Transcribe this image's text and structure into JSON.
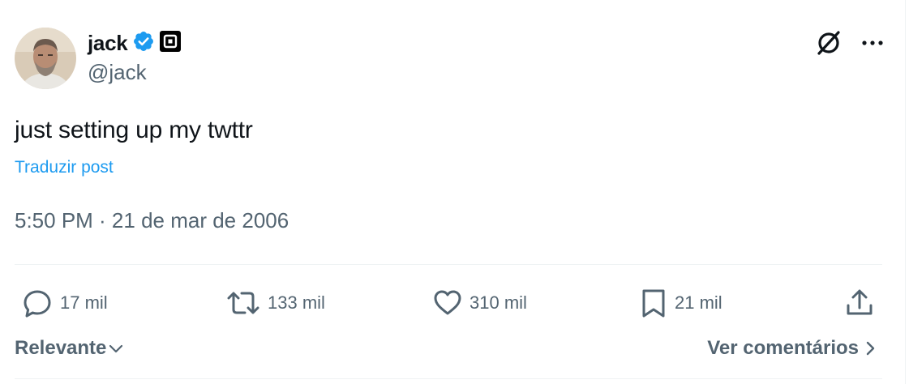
{
  "author": {
    "display_name": "jack",
    "handle": "@jack",
    "verified_icon": "verified-badge-icon",
    "affiliation_icon": "square-logo-icon"
  },
  "tweet": {
    "text": "just setting up my twttr",
    "translate_label": "Traduzir post",
    "timestamp": "5:50 PM · 21 de mar de 2006"
  },
  "actions": {
    "replies": "17 mil",
    "reposts": "133 mil",
    "likes": "310 mil",
    "bookmarks": "21 mil"
  },
  "replies_section": {
    "sort_label": "Relevante",
    "see_comments_label": "Ver comentários"
  },
  "colors": {
    "accent": "#1d9bf0",
    "secondary_text": "#536471",
    "divider": "#eff3f4"
  }
}
